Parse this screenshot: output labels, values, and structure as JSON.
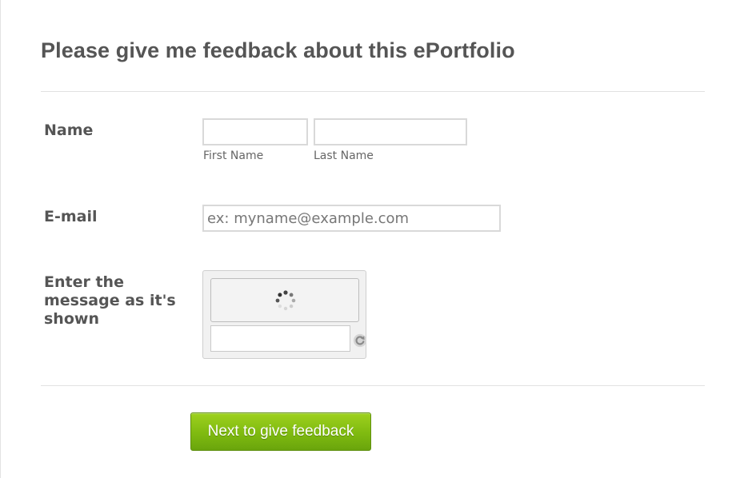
{
  "form": {
    "title": "Please give me feedback about this ePortfolio"
  },
  "fields": {
    "name": {
      "label": "Name",
      "first_value": "",
      "last_value": "",
      "first_sublabel": "First Name",
      "last_sublabel": "Last Name"
    },
    "email": {
      "label": "E-mail",
      "value": "",
      "placeholder": "ex: myname@example.com"
    },
    "captcha": {
      "label": "Enter the message as it's shown",
      "value": "",
      "loading_icon": "spinner-icon",
      "refresh_icon": "refresh-icon"
    }
  },
  "submit": {
    "label": "Next to give feedback"
  },
  "colors": {
    "button_green": "#7fba10",
    "text": "#555555",
    "divider": "#e1e1e1"
  }
}
